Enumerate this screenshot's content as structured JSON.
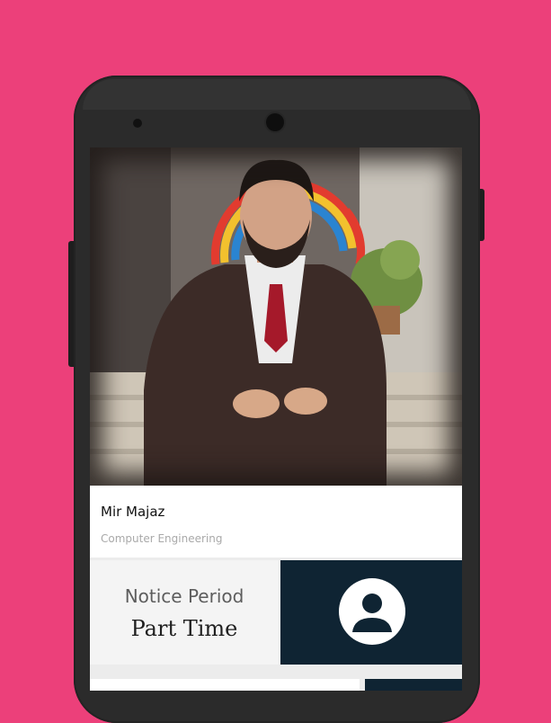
{
  "profile": {
    "name": "Mir Majaz",
    "department": "Computer Engineering",
    "photo_icon": "person-photo"
  },
  "status_card": {
    "label": "Notice Period",
    "value": "Part Time"
  },
  "avatar_card": {
    "icon": "account-circle-icon",
    "background_color": "#0f2433"
  },
  "theme": {
    "background_color": "#EC407A",
    "phone_color": "#2b2b2b"
  }
}
